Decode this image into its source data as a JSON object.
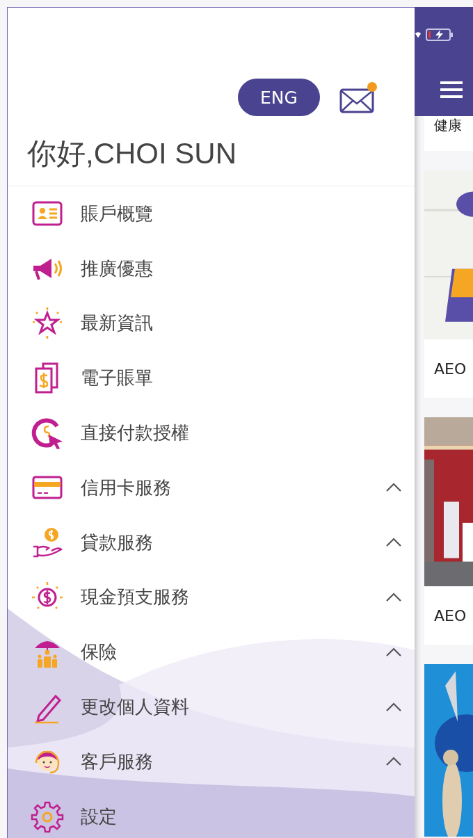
{
  "drawer": {
    "language_button": "ENG",
    "mail": {
      "unread": true
    },
    "greeting": "你好,CHOI SUN",
    "items": [
      {
        "label": "賬戶概覽",
        "expandable": false
      },
      {
        "label": "推廣優惠",
        "expandable": false
      },
      {
        "label": "最新資訊",
        "expandable": false
      },
      {
        "label": "電子賬單",
        "expandable": false
      },
      {
        "label": "直接付款授權",
        "expandable": false
      },
      {
        "label": "信用卡服務",
        "expandable": true
      },
      {
        "label": "貸款服務",
        "expandable": true
      },
      {
        "label": "現金預支服務",
        "expandable": true
      },
      {
        "label": "保險",
        "expandable": true
      },
      {
        "label": "更改個人資料",
        "expandable": true
      },
      {
        "label": "客戶服務",
        "expandable": true
      },
      {
        "label": "設定",
        "expandable": false
      }
    ]
  },
  "background_page": {
    "cards": [
      {
        "kind": "text",
        "text": "健康"
      },
      {
        "kind": "picture"
      },
      {
        "kind": "text",
        "text": "AEO"
      },
      {
        "kind": "picture"
      },
      {
        "kind": "text",
        "text": "AEO"
      },
      {
        "kind": "picture"
      }
    ]
  }
}
